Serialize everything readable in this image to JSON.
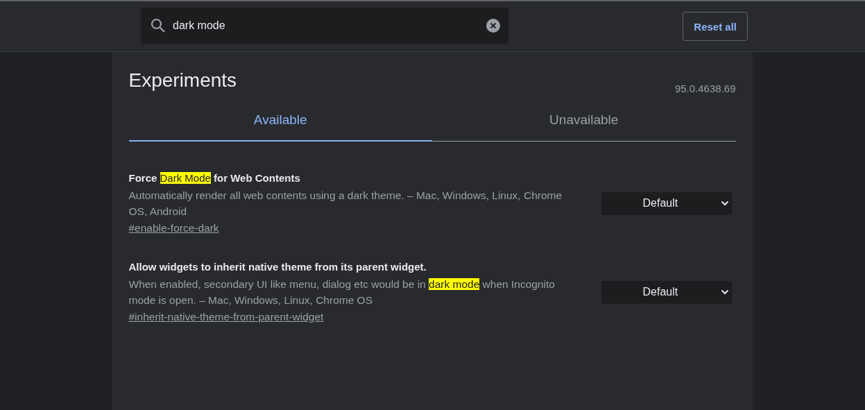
{
  "search": {
    "value": "dark mode"
  },
  "reset_button": "Reset all",
  "title": "Experiments",
  "version": "95.0.4638.69",
  "tabs": [
    {
      "label": "Available",
      "selected": true
    },
    {
      "label": "Unavailable",
      "selected": false
    }
  ],
  "experiments": [
    {
      "title": [
        {
          "text": "Force ",
          "highlight": false
        },
        {
          "text": "Dark Mode",
          "highlight": true
        },
        {
          "text": " for Web Contents",
          "highlight": false
        }
      ],
      "description": [
        {
          "text": "Automatically render all web contents using a dark theme. – Mac, Windows, Linux, Chrome OS, Android",
          "highlight": false
        }
      ],
      "link": "#enable-force-dark",
      "value": "Default"
    },
    {
      "title": [
        {
          "text": "Allow widgets to inherit native theme from its parent widget.",
          "highlight": false
        }
      ],
      "description": [
        {
          "text": "When enabled, secondary UI like menu, dialog etc would be in ",
          "highlight": false
        },
        {
          "text": "dark mode",
          "highlight": true
        },
        {
          "text": " when Incognito mode is open. – Mac, Windows, Linux, Chrome OS",
          "highlight": false
        }
      ],
      "link": "#inherit-native-theme-from-parent-widget",
      "value": "Default"
    }
  ]
}
